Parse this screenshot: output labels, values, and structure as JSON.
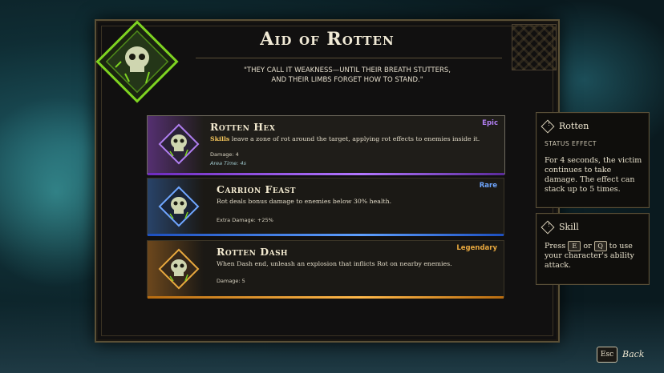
{
  "window": {
    "title": "Aid of Rotten",
    "quote_line1": "\"THEY CALL IT WEAKNESS—UNTIL THEIR BREATH STUTTERS,",
    "quote_line2": "AND THEIR LIMBS FORGET HOW TO STAND.\""
  },
  "cards": [
    {
      "name": "Rotten Hex",
      "rarity": "Epic",
      "desc_keyword": "Skills",
      "desc": " leave a zone of rot around the target, applying rot effects to enemies inside it.",
      "stats": [
        "Damage: 4",
        "Area Time: 4s"
      ],
      "icon": "skull-rune-icon"
    },
    {
      "name": "Carrion Feast",
      "rarity": "Rare",
      "desc_keyword": "",
      "desc": "Rot deals bonus damage to enemies below 30% health.",
      "stats": [
        "Extra Damage: +25%"
      ],
      "icon": "skull-rune-icon"
    },
    {
      "name": "Rotten Dash",
      "rarity": "Legendary",
      "desc_keyword": "",
      "desc": "When Dash end, unleash an explosion that inflicts Rot on nearby enemies.",
      "stats": [
        "Damage: 5"
      ],
      "icon": "skull-rune-icon"
    }
  ],
  "tooltips": {
    "rotten": {
      "title": "Rotten",
      "subtitle": "STATUS EFFECT",
      "body": "For 4 seconds, the victim continues to take damage. The effect can stack up to 5 times."
    },
    "skill": {
      "title": "Skill",
      "body_pre": "Press ",
      "key1": "E",
      "body_or": " or ",
      "key2": "Q",
      "body_post": " to use your character's ability attack."
    }
  },
  "footer": {
    "esc_key": "Esc",
    "back_label": "Back"
  },
  "colors": {
    "epic": "#b07ef0",
    "rare": "#6fa6ff",
    "legendary": "#e8a83e",
    "keyword": "#f1c35a",
    "emblem_green": "#7ed321"
  }
}
